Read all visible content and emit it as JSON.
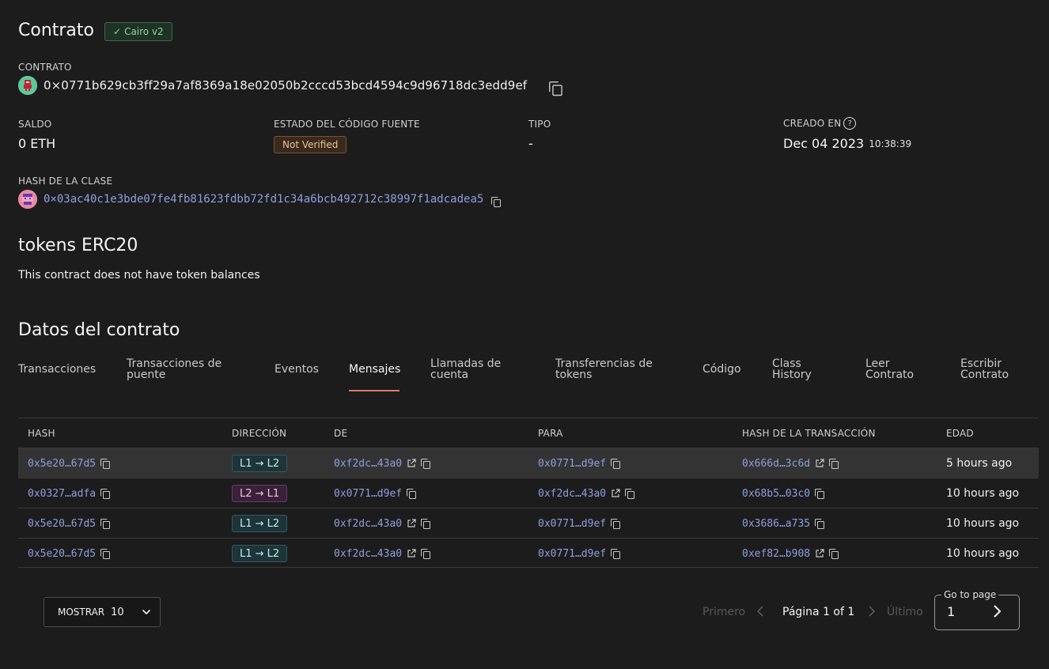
{
  "header": {
    "title": "Contrato",
    "badge": "Cairo v2"
  },
  "contract": {
    "label": "CONTRATO",
    "address": "0×0771b629cb3ff29a7af8369a18e02050b2cccd53bcd4594c9d96718dc3edd9ef"
  },
  "stats": {
    "saldo_label": "SALDO",
    "saldo_value": "0 ETH",
    "estado_label": "ESTADO DEL CÓDIGO FUENTE",
    "estado_value": "Not Verified",
    "tipo_label": "TIPO",
    "tipo_value": "-",
    "creado_label": "CREADO EN",
    "creado_date": "Dec 04 2023",
    "creado_time": "10:38:39"
  },
  "class_hash": {
    "label": "HASH DE LA CLASE",
    "value": "0×03ac40c1e3bde07fe4fb81623fdbb72fd1c34a6bcb492712c38997f1adcadea5"
  },
  "tokens": {
    "title": "tokens ERC20",
    "empty_text": "This contract does not have token balances"
  },
  "datos": {
    "title": "Datos del contrato",
    "tabs": [
      {
        "line1": "Transacciones",
        "line2": ""
      },
      {
        "line1": "Transacciones de",
        "line2": "puente"
      },
      {
        "line1": "Eventos",
        "line2": ""
      },
      {
        "line1": "Mensajes",
        "line2": ""
      },
      {
        "line1": "Llamadas de",
        "line2": "cuenta"
      },
      {
        "line1": "Transferencias de",
        "line2": "tokens"
      },
      {
        "line1": "Código",
        "line2": ""
      },
      {
        "line1": "Class",
        "line2": "History"
      },
      {
        "line1": "Leer",
        "line2": "Contrato"
      },
      {
        "line1": "Escribir",
        "line2": "Contrato"
      }
    ],
    "active_tab": "Mensajes"
  },
  "table": {
    "headers": {
      "hash": "HASH",
      "direccion": "DIRECCIÓN",
      "de": "DE",
      "para": "PARA",
      "tx_hash": "HASH DE LA TRANSACCIÓN",
      "edad": "EDAD"
    },
    "rows": [
      {
        "hash": "0x5e20…67d5",
        "direccion": "L1 → L2",
        "de": "0xf2dc…43a0",
        "para": "0x0771…d9ef",
        "tx_hash": "0x666d…3c6d",
        "edad": "5 hours ago"
      },
      {
        "hash": "0x0327…adfa",
        "direccion": "L2 → L1",
        "de": "0x0771…d9ef",
        "para": "0xf2dc…43a0",
        "tx_hash": "0x68b5…03c0",
        "edad": "10 hours ago"
      },
      {
        "hash": "0x5e20…67d5",
        "direccion": "L1 → L2",
        "de": "0xf2dc…43a0",
        "para": "0x0771…d9ef",
        "tx_hash": "0x3686…a735",
        "edad": "10 hours ago"
      },
      {
        "hash": "0x5e20…67d5",
        "direccion": "L1 → L2",
        "de": "0xf2dc…43a0",
        "para": "0x0771…d9ef",
        "tx_hash": "0xef82…b908",
        "edad": "10 hours ago"
      }
    ]
  },
  "pagination": {
    "mostrar_label": "MOSTRAR",
    "mostrar_value": "10",
    "primero": "Primero",
    "pagina": "Página 1 of 1",
    "ultimo": "Último",
    "goto_label": "Go to page",
    "goto_value": "1"
  },
  "colors": {
    "background": "#1c1c1c",
    "link": "#8e9fe0",
    "accent_underline": "#e07a5f",
    "badge_green": "#8fd6a4",
    "badge_orange": "#f0c29a"
  }
}
